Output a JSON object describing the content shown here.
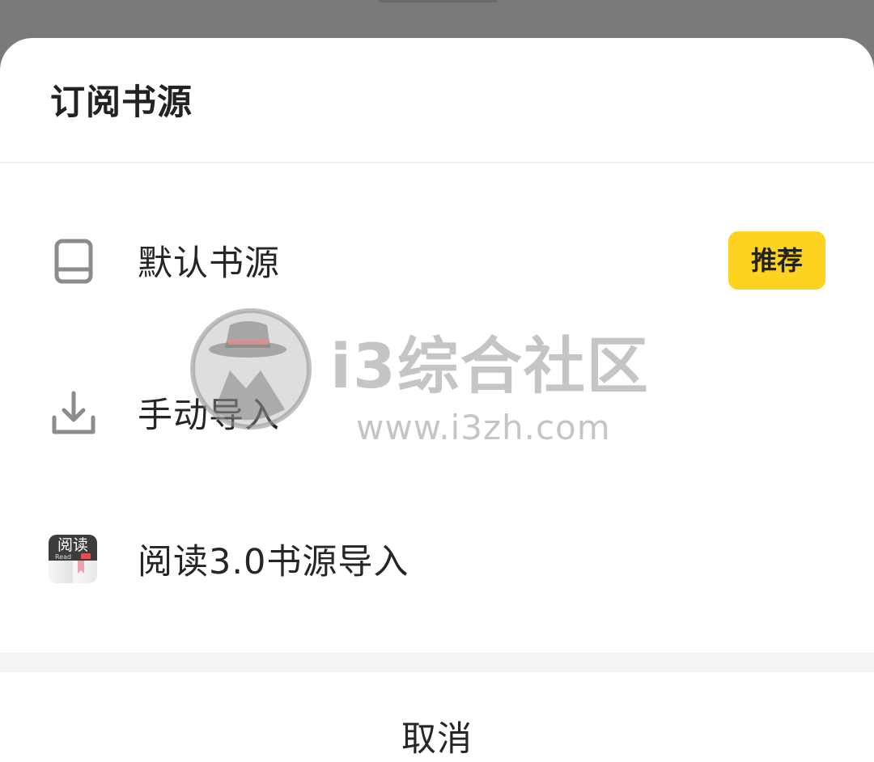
{
  "sheet": {
    "title": "订阅书源"
  },
  "options": [
    {
      "label": "默认书源",
      "icon": "book-icon",
      "badge": "推荐"
    },
    {
      "label": "手动导入",
      "icon": "download-icon"
    },
    {
      "label": "阅读3.0书源导入",
      "icon": "legado-app-icon",
      "app_icon_text": "阅读",
      "app_icon_sub": "Read"
    }
  ],
  "cancel_label": "取消",
  "watermark": {
    "title": "i3综合社区",
    "url": "www.i3zh.com"
  },
  "colors": {
    "badge": "#fdd31f",
    "backdrop": "#7a7a7a",
    "text": "#262626"
  }
}
